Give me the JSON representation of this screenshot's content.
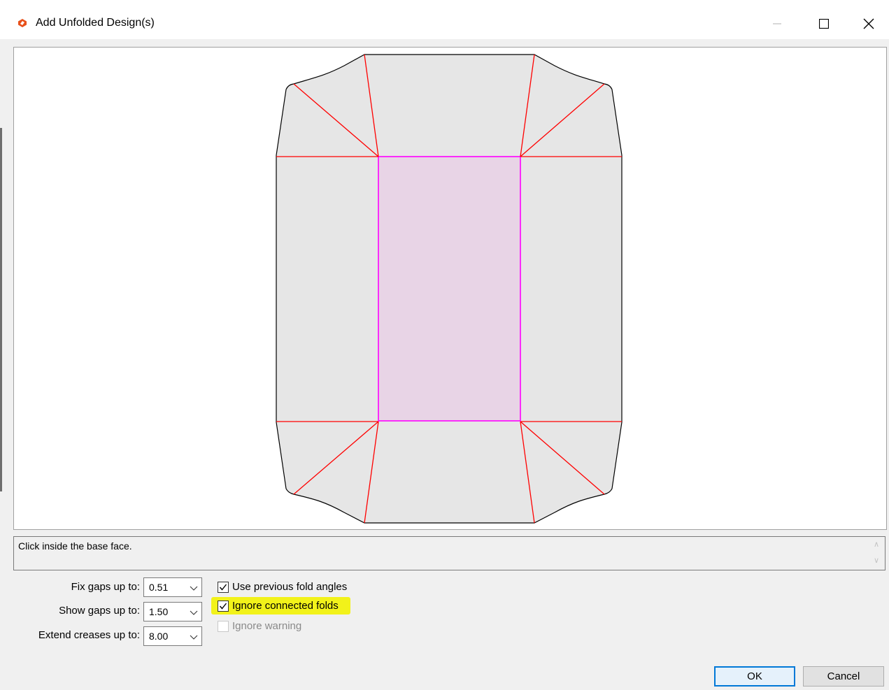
{
  "window": {
    "title": "Add Unfolded Design(s)",
    "controls": [
      "minimize",
      "maximize",
      "close"
    ]
  },
  "canvas": {
    "colors": {
      "background": "#ffffff",
      "face_fill": "#e6e6e6",
      "base_face_fill": "#e8d4e6",
      "base_face_stroke": "#ff00ff",
      "fold_line": "#ff0000",
      "outline": "#000000"
    }
  },
  "message": {
    "text": "Click inside the base face."
  },
  "options": {
    "fix_gaps": {
      "label": "Fix gaps up to:",
      "value": "0.51"
    },
    "show_gaps": {
      "label": "Show gaps up to:",
      "value": "1.50"
    },
    "extend_creases": {
      "label": "Extend creases up to:",
      "value": "8.00"
    }
  },
  "checkboxes": {
    "use_previous": {
      "label": "Use previous fold angles",
      "checked": true,
      "enabled": true
    },
    "ignore_connected": {
      "label": "Ignore connected folds",
      "checked": true,
      "enabled": true
    },
    "ignore_warning": {
      "label": "Ignore warning",
      "checked": false,
      "enabled": false
    }
  },
  "buttons": {
    "ok": "OK",
    "cancel": "Cancel"
  },
  "icons": {
    "app": "app-logo-icon",
    "minimize": "minimize-icon",
    "maximize": "maximize-icon",
    "close": "close-icon",
    "dropdown": "chevron-down-icon",
    "check": "checkmark-icon"
  },
  "highlight_color": "#f2f21a"
}
